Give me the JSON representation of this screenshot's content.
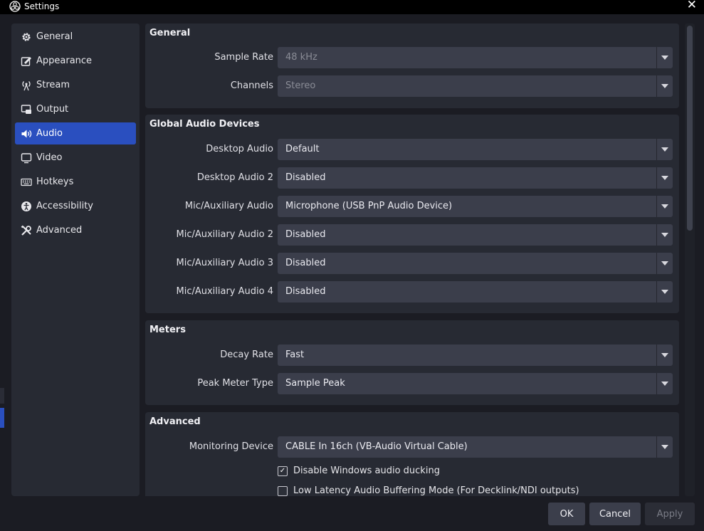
{
  "window": {
    "title": "Settings",
    "close_glyph": "✕"
  },
  "sidebar": {
    "items": [
      {
        "label": "General",
        "icon": "gear-icon"
      },
      {
        "label": "Appearance",
        "icon": "appearance-icon"
      },
      {
        "label": "Stream",
        "icon": "antenna-icon"
      },
      {
        "label": "Output",
        "icon": "output-icon"
      },
      {
        "label": "Audio",
        "icon": "speaker-icon",
        "active": true
      },
      {
        "label": "Video",
        "icon": "monitor-icon"
      },
      {
        "label": "Hotkeys",
        "icon": "keyboard-icon"
      },
      {
        "label": "Accessibility",
        "icon": "accessibility-icon"
      },
      {
        "label": "Advanced",
        "icon": "tools-icon"
      }
    ]
  },
  "groups": {
    "general": {
      "title": "General",
      "sample_rate": {
        "label": "Sample Rate",
        "value": "48 kHz"
      },
      "channels": {
        "label": "Channels",
        "value": "Stereo"
      }
    },
    "global_audio": {
      "title": "Global Audio Devices",
      "desktop_audio": {
        "label": "Desktop Audio",
        "value": "Default"
      },
      "desktop_audio_2": {
        "label": "Desktop Audio 2",
        "value": "Disabled"
      },
      "mic_aux": {
        "label": "Mic/Auxiliary Audio",
        "value": "Microphone (USB PnP Audio Device)"
      },
      "mic_aux_2": {
        "label": "Mic/Auxiliary Audio 2",
        "value": "Disabled"
      },
      "mic_aux_3": {
        "label": "Mic/Auxiliary Audio 3",
        "value": "Disabled"
      },
      "mic_aux_4": {
        "label": "Mic/Auxiliary Audio 4",
        "value": "Disabled"
      }
    },
    "meters": {
      "title": "Meters",
      "decay_rate": {
        "label": "Decay Rate",
        "value": "Fast"
      },
      "peak_meter_type": {
        "label": "Peak Meter Type",
        "value": "Sample Peak"
      }
    },
    "advanced": {
      "title": "Advanced",
      "monitoring_device": {
        "label": "Monitoring Device",
        "value": "CABLE In 16ch (VB-Audio Virtual Cable)"
      },
      "disable_ducking": {
        "label": "Disable Windows audio ducking",
        "checked": true
      },
      "low_latency": {
        "label": "Low Latency Audio Buffering Mode (For Decklink/NDI outputs)",
        "checked": false
      }
    }
  },
  "buttons": {
    "ok": "OK",
    "cancel": "Cancel",
    "apply": "Apply"
  },
  "colors": {
    "accent": "#2a4fbf",
    "background": "#1b1c23",
    "panel": "#272a33",
    "combo": "#3b3e4b"
  }
}
